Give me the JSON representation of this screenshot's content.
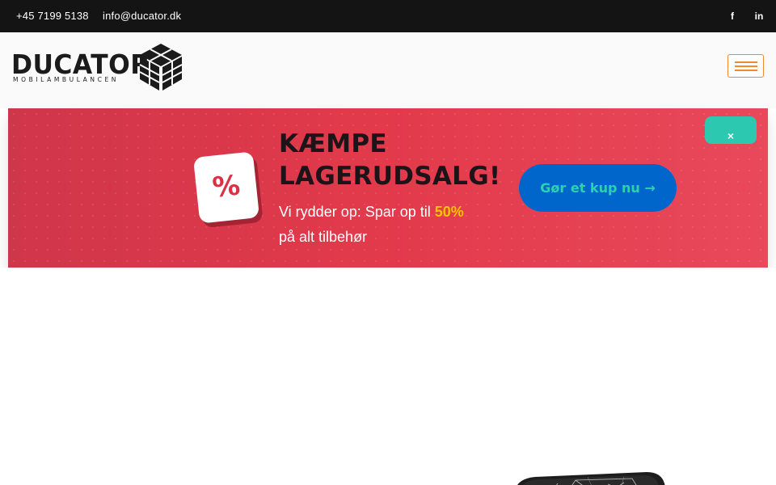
{
  "topbar": {
    "phone": "+45 7199 5138",
    "email": "info@ducator.dk",
    "social": [
      {
        "icon": "facebook-icon",
        "glyph": "f"
      },
      {
        "icon": "linkedin-icon",
        "glyph": "in"
      }
    ]
  },
  "header": {
    "logo_word": "DUCATOR",
    "logo_tagline": "MOBILAMBULANCEN",
    "menu_icon": "hamburger-menu-icon"
  },
  "promo": {
    "badge_symbol": "%",
    "headline_line1": "KÆMPE",
    "headline_line2": "LAGERUDSALG!",
    "sub_prefix": "Vi rydder op: Spar op til ",
    "sub_highlight": "50%",
    "sub_suffix": "på alt tilbehør",
    "cta_label": "Gør et kup nu →",
    "close_label": "×",
    "colors": {
      "banner": "#e23a4b",
      "cta_bg": "#0066cc",
      "cta_text": "#29d3b0",
      "highlight": "#ffc300",
      "close_bg": "#2cc8b0"
    }
  },
  "colors": {
    "topbar": "#141414",
    "menu_accent": "#f08a30"
  }
}
